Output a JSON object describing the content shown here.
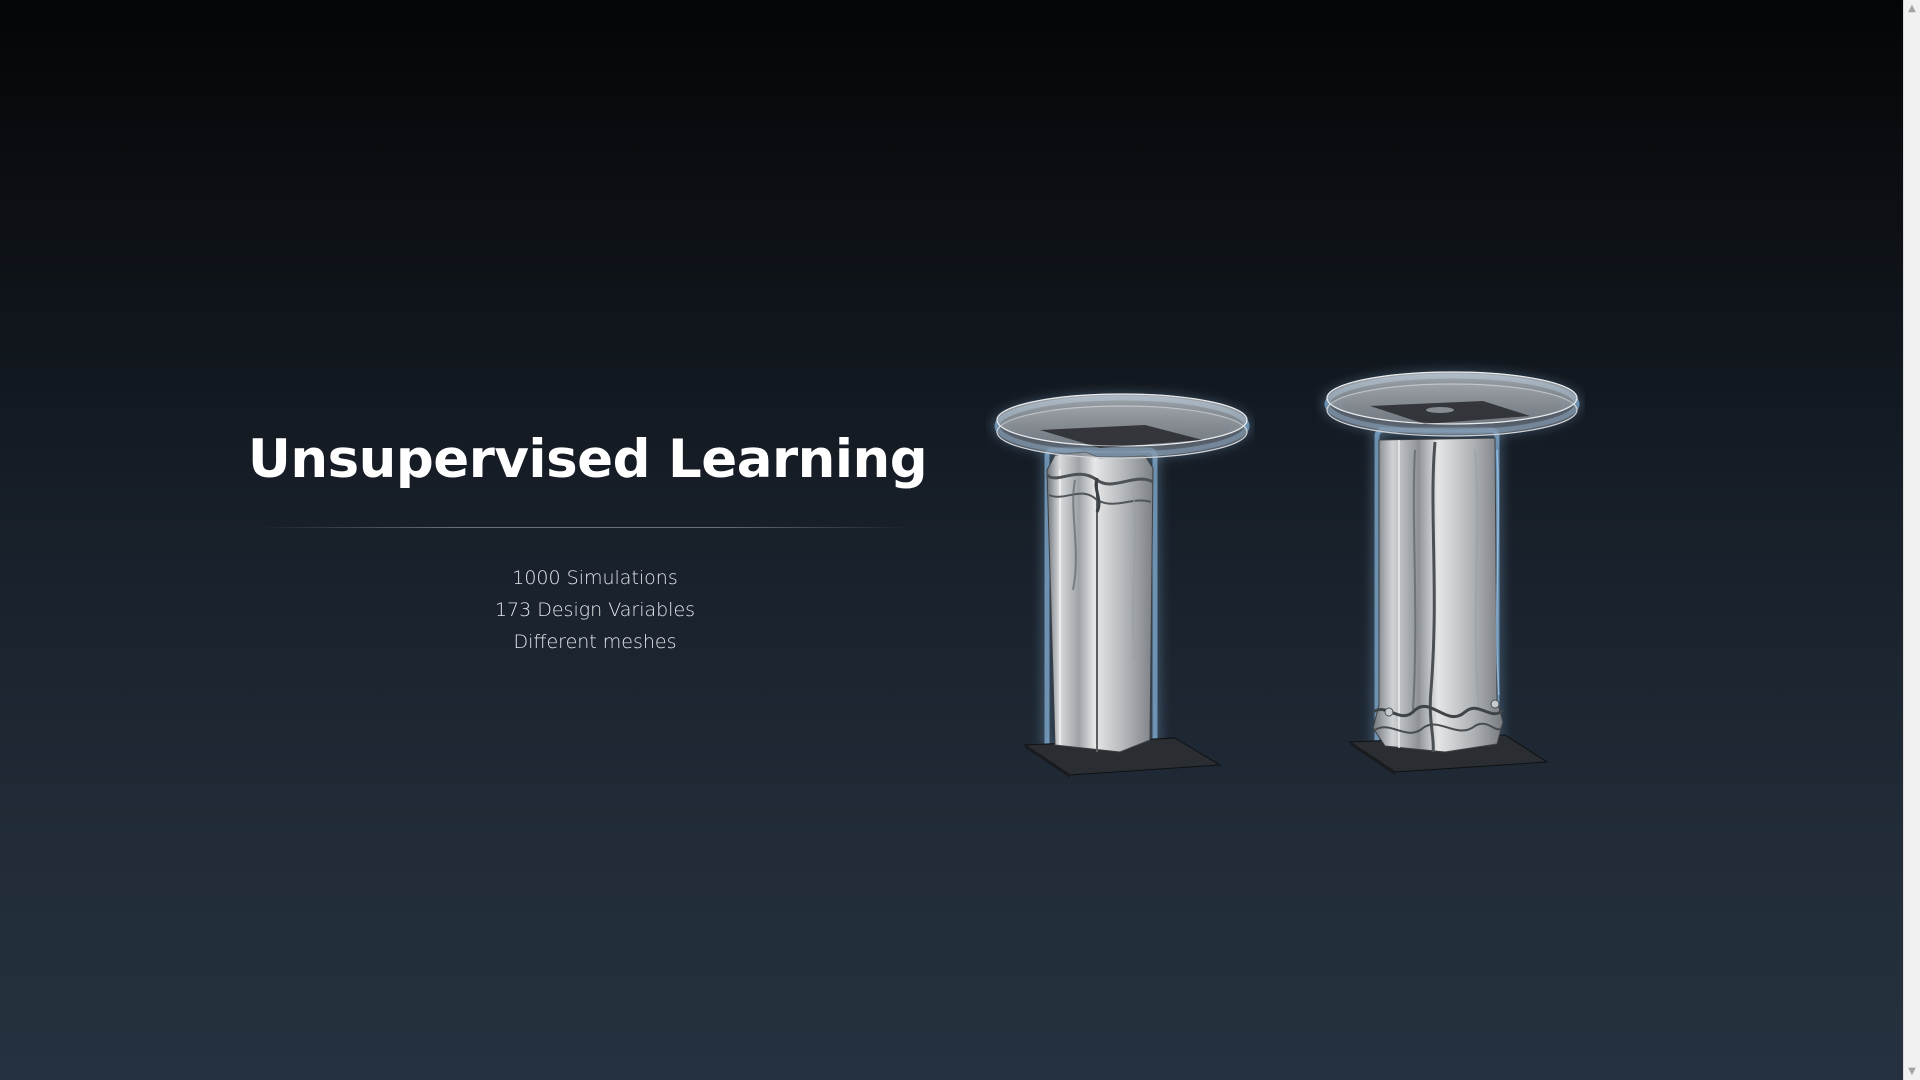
{
  "slide": {
    "title": "Unsupervised Learning",
    "facts": [
      "1000 Simulations",
      "173 Design Variables",
      "Different meshes"
    ]
  },
  "figures": [
    {
      "name": "crash-column-left",
      "depiction": "crushed rectangular column between a disc impactor and a base plate, buckled near the top"
    },
    {
      "name": "crash-column-right",
      "depiction": "crushed rectangular column between a disc impactor and a base plate, buckled near the bottom"
    }
  ],
  "colors": {
    "background_top": "#040507",
    "background_bottom": "#25313e",
    "title": "#ffffff",
    "text": "#e3e7ec",
    "glow": "#9fd3ff"
  },
  "icons": {
    "scroll_up": "scroll-up-arrow-icon",
    "scroll_down": "scroll-down-arrow-icon"
  }
}
